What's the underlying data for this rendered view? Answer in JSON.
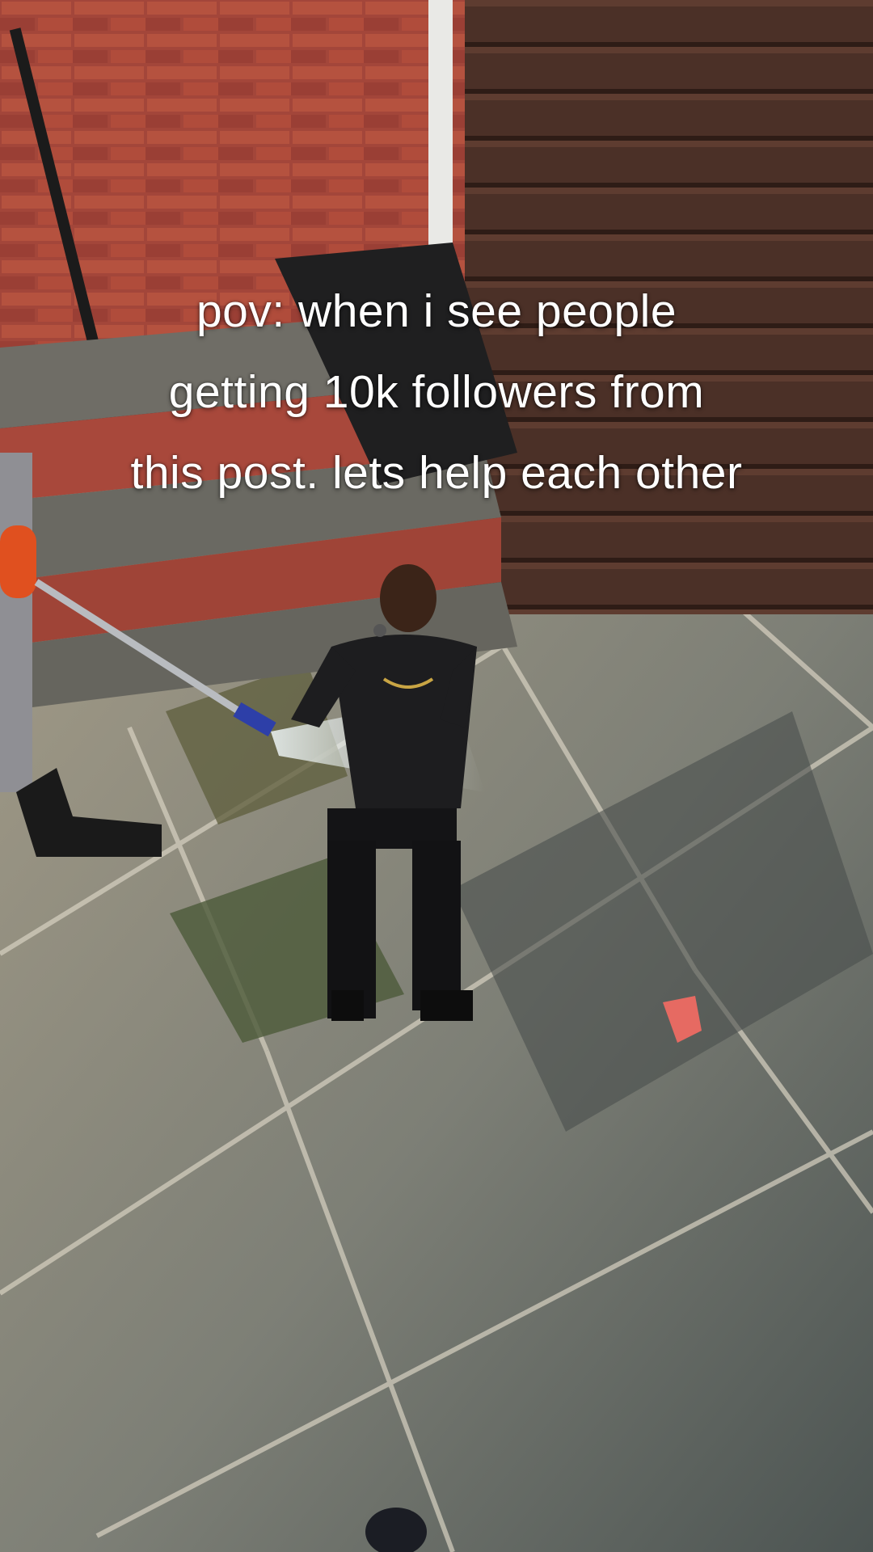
{
  "video": {
    "caption_lines": [
      "pov: when i see people",
      "getting 10k followers from",
      "this post. lets help each other"
    ]
  },
  "colors": {
    "brick": "#a8453a",
    "fence": "#4a2f26",
    "patio_light": "#9c9685",
    "patio_dark": "#4d5351",
    "caption_text": "#ffffff"
  }
}
